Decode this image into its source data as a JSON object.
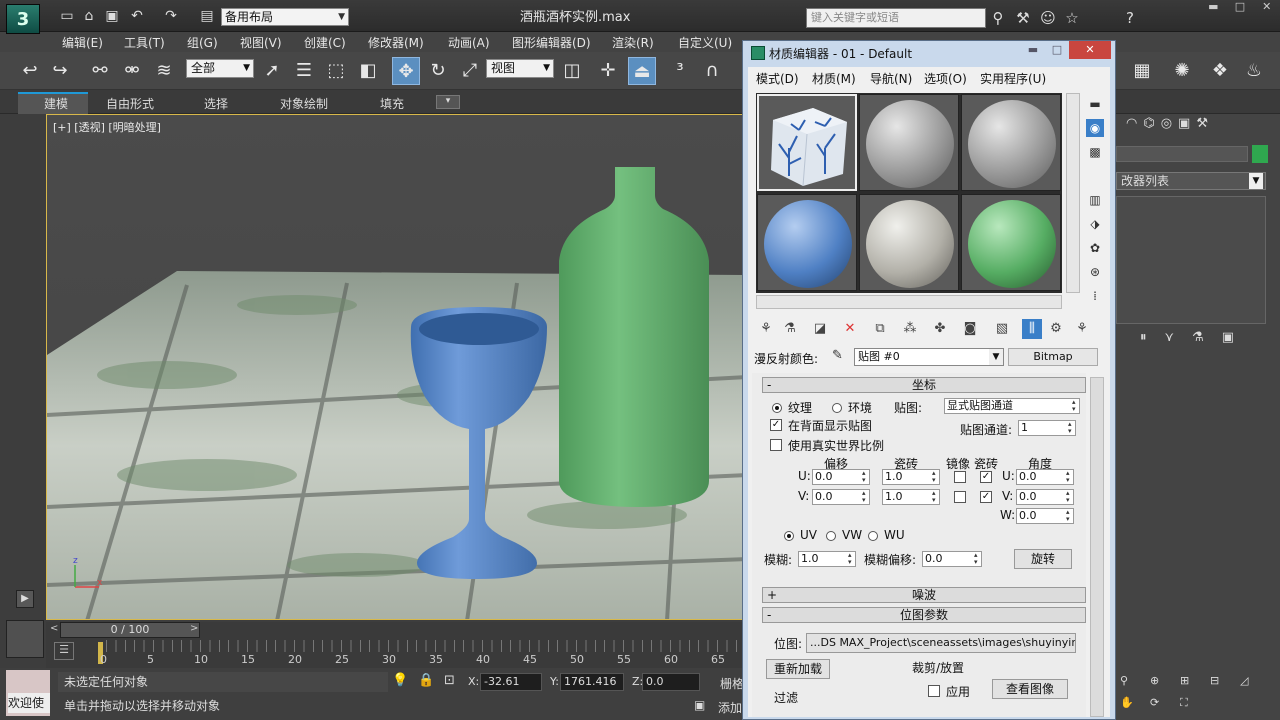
{
  "title": {
    "file": "酒瓶酒杯实例.max",
    "workspace": "备用布局",
    "search_placeholder": "键入关键字或短语",
    "app_icon": "3ds-max-logo"
  },
  "menus": [
    "编辑(E)",
    "工具(T)",
    "组(G)",
    "视图(V)",
    "创建(C)",
    "修改器(M)",
    "动画(A)",
    "图形编辑器(D)",
    "渲染(R)",
    "自定义(U)"
  ],
  "toolbar": {
    "selection_filter": "全部",
    "ref_coord": "视图"
  },
  "ribbon": {
    "tabs": [
      "建模",
      "自由形式",
      "选择",
      "对象绘制",
      "填充"
    ]
  },
  "viewport": {
    "label": "[+] [透视] [明暗处理]"
  },
  "timeline": {
    "frame": "0 / 100",
    "ticks": [
      "0",
      "5",
      "10",
      "15",
      "20",
      "25",
      "30",
      "35",
      "40",
      "45",
      "50",
      "55",
      "60",
      "65"
    ]
  },
  "status": {
    "maxscript": "欢迎使",
    "selection": "未选定任何对象",
    "prompt": "单击并拖动以选择并移动对象",
    "x": "-32.61",
    "y": "1761.416",
    "z": "0.0",
    "grid_prefix": "栅格",
    "add_tag": "添加"
  },
  "right_panel": {
    "modifier_list": "改器列表"
  },
  "material_editor": {
    "title": "材质编辑器 - 01 - Default",
    "menus": [
      "模式(D)",
      "材质(M)",
      "导航(N)",
      "选项(O)",
      "实用程序(U)"
    ],
    "diffuse_label": "漫反射颜色:",
    "map_name": "贴图 #0",
    "map_type": "Bitmap",
    "coords": {
      "header": "坐标",
      "texture": "纹理",
      "env": "环境",
      "mapping_label": "贴图:",
      "mapping_value": "显式贴图通道",
      "show_back": "在背面显示贴图",
      "map_channel_label": "贴图通道:",
      "map_channel": "1",
      "real_world": "使用真实世界比例",
      "offset": "偏移",
      "tiling": "瓷砖",
      "mirror": "镜像",
      "tile": "瓷砖",
      "angle": "角度",
      "u": "U:",
      "v": "V:",
      "w": "W:",
      "u_offset": "0.0",
      "v_offset": "0.0",
      "u_tiling": "1.0",
      "v_tiling": "1.0",
      "u_angle": "0.0",
      "v_angle": "0.0",
      "w_angle": "0.0",
      "uv": "UV",
      "vw": "VW",
      "wu": "WU",
      "blur_label": "模糊:",
      "blur": "1.0",
      "blur_offset_label": "模糊偏移:",
      "blur_offset": "0.0",
      "rotate": "旋转"
    },
    "noise_header": "噪波",
    "bitmap_header": "位图参数",
    "bitmap_label": "位图:",
    "bitmap_path": "...DS MAX_Project\\sceneassets\\images\\shuyinying.jpg",
    "reload": "重新加载",
    "crop_group": "裁剪/放置",
    "apply": "应用",
    "view_image": "查看图像",
    "filter_group": "过滤"
  },
  "colors": {
    "accent": "#1f99d7",
    "bottle": "#5fae6c",
    "glass": "#5b8fd1",
    "active_btn": "#5b8fc0"
  }
}
